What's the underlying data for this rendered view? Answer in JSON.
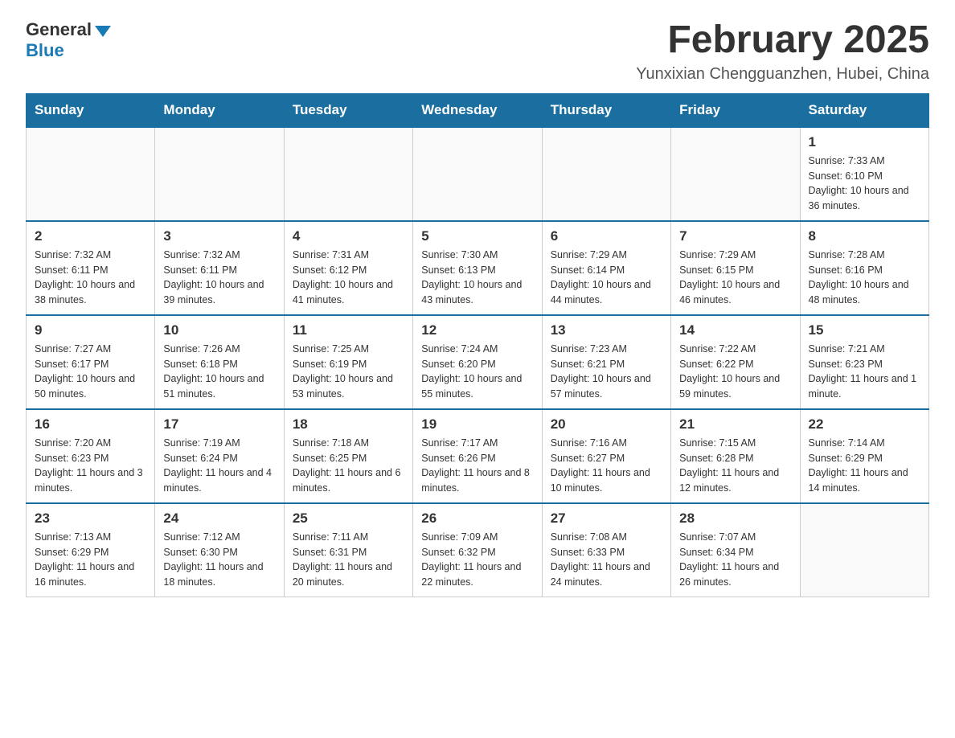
{
  "logo": {
    "general": "General",
    "blue": "Blue"
  },
  "title": "February 2025",
  "location": "Yunxixian Chengguanzhen, Hubei, China",
  "days_header": [
    "Sunday",
    "Monday",
    "Tuesday",
    "Wednesday",
    "Thursday",
    "Friday",
    "Saturday"
  ],
  "weeks": [
    [
      {
        "day": "",
        "sunrise": "",
        "sunset": "",
        "daylight": ""
      },
      {
        "day": "",
        "sunrise": "",
        "sunset": "",
        "daylight": ""
      },
      {
        "day": "",
        "sunrise": "",
        "sunset": "",
        "daylight": ""
      },
      {
        "day": "",
        "sunrise": "",
        "sunset": "",
        "daylight": ""
      },
      {
        "day": "",
        "sunrise": "",
        "sunset": "",
        "daylight": ""
      },
      {
        "day": "",
        "sunrise": "",
        "sunset": "",
        "daylight": ""
      },
      {
        "day": "1",
        "sunrise": "Sunrise: 7:33 AM",
        "sunset": "Sunset: 6:10 PM",
        "daylight": "Daylight: 10 hours and 36 minutes."
      }
    ],
    [
      {
        "day": "2",
        "sunrise": "Sunrise: 7:32 AM",
        "sunset": "Sunset: 6:11 PM",
        "daylight": "Daylight: 10 hours and 38 minutes."
      },
      {
        "day": "3",
        "sunrise": "Sunrise: 7:32 AM",
        "sunset": "Sunset: 6:11 PM",
        "daylight": "Daylight: 10 hours and 39 minutes."
      },
      {
        "day": "4",
        "sunrise": "Sunrise: 7:31 AM",
        "sunset": "Sunset: 6:12 PM",
        "daylight": "Daylight: 10 hours and 41 minutes."
      },
      {
        "day": "5",
        "sunrise": "Sunrise: 7:30 AM",
        "sunset": "Sunset: 6:13 PM",
        "daylight": "Daylight: 10 hours and 43 minutes."
      },
      {
        "day": "6",
        "sunrise": "Sunrise: 7:29 AM",
        "sunset": "Sunset: 6:14 PM",
        "daylight": "Daylight: 10 hours and 44 minutes."
      },
      {
        "day": "7",
        "sunrise": "Sunrise: 7:29 AM",
        "sunset": "Sunset: 6:15 PM",
        "daylight": "Daylight: 10 hours and 46 minutes."
      },
      {
        "day": "8",
        "sunrise": "Sunrise: 7:28 AM",
        "sunset": "Sunset: 6:16 PM",
        "daylight": "Daylight: 10 hours and 48 minutes."
      }
    ],
    [
      {
        "day": "9",
        "sunrise": "Sunrise: 7:27 AM",
        "sunset": "Sunset: 6:17 PM",
        "daylight": "Daylight: 10 hours and 50 minutes."
      },
      {
        "day": "10",
        "sunrise": "Sunrise: 7:26 AM",
        "sunset": "Sunset: 6:18 PM",
        "daylight": "Daylight: 10 hours and 51 minutes."
      },
      {
        "day": "11",
        "sunrise": "Sunrise: 7:25 AM",
        "sunset": "Sunset: 6:19 PM",
        "daylight": "Daylight: 10 hours and 53 minutes."
      },
      {
        "day": "12",
        "sunrise": "Sunrise: 7:24 AM",
        "sunset": "Sunset: 6:20 PM",
        "daylight": "Daylight: 10 hours and 55 minutes."
      },
      {
        "day": "13",
        "sunrise": "Sunrise: 7:23 AM",
        "sunset": "Sunset: 6:21 PM",
        "daylight": "Daylight: 10 hours and 57 minutes."
      },
      {
        "day": "14",
        "sunrise": "Sunrise: 7:22 AM",
        "sunset": "Sunset: 6:22 PM",
        "daylight": "Daylight: 10 hours and 59 minutes."
      },
      {
        "day": "15",
        "sunrise": "Sunrise: 7:21 AM",
        "sunset": "Sunset: 6:23 PM",
        "daylight": "Daylight: 11 hours and 1 minute."
      }
    ],
    [
      {
        "day": "16",
        "sunrise": "Sunrise: 7:20 AM",
        "sunset": "Sunset: 6:23 PM",
        "daylight": "Daylight: 11 hours and 3 minutes."
      },
      {
        "day": "17",
        "sunrise": "Sunrise: 7:19 AM",
        "sunset": "Sunset: 6:24 PM",
        "daylight": "Daylight: 11 hours and 4 minutes."
      },
      {
        "day": "18",
        "sunrise": "Sunrise: 7:18 AM",
        "sunset": "Sunset: 6:25 PM",
        "daylight": "Daylight: 11 hours and 6 minutes."
      },
      {
        "day": "19",
        "sunrise": "Sunrise: 7:17 AM",
        "sunset": "Sunset: 6:26 PM",
        "daylight": "Daylight: 11 hours and 8 minutes."
      },
      {
        "day": "20",
        "sunrise": "Sunrise: 7:16 AM",
        "sunset": "Sunset: 6:27 PM",
        "daylight": "Daylight: 11 hours and 10 minutes."
      },
      {
        "day": "21",
        "sunrise": "Sunrise: 7:15 AM",
        "sunset": "Sunset: 6:28 PM",
        "daylight": "Daylight: 11 hours and 12 minutes."
      },
      {
        "day": "22",
        "sunrise": "Sunrise: 7:14 AM",
        "sunset": "Sunset: 6:29 PM",
        "daylight": "Daylight: 11 hours and 14 minutes."
      }
    ],
    [
      {
        "day": "23",
        "sunrise": "Sunrise: 7:13 AM",
        "sunset": "Sunset: 6:29 PM",
        "daylight": "Daylight: 11 hours and 16 minutes."
      },
      {
        "day": "24",
        "sunrise": "Sunrise: 7:12 AM",
        "sunset": "Sunset: 6:30 PM",
        "daylight": "Daylight: 11 hours and 18 minutes."
      },
      {
        "day": "25",
        "sunrise": "Sunrise: 7:11 AM",
        "sunset": "Sunset: 6:31 PM",
        "daylight": "Daylight: 11 hours and 20 minutes."
      },
      {
        "day": "26",
        "sunrise": "Sunrise: 7:09 AM",
        "sunset": "Sunset: 6:32 PM",
        "daylight": "Daylight: 11 hours and 22 minutes."
      },
      {
        "day": "27",
        "sunrise": "Sunrise: 7:08 AM",
        "sunset": "Sunset: 6:33 PM",
        "daylight": "Daylight: 11 hours and 24 minutes."
      },
      {
        "day": "28",
        "sunrise": "Sunrise: 7:07 AM",
        "sunset": "Sunset: 6:34 PM",
        "daylight": "Daylight: 11 hours and 26 minutes."
      },
      {
        "day": "",
        "sunrise": "",
        "sunset": "",
        "daylight": ""
      }
    ]
  ]
}
